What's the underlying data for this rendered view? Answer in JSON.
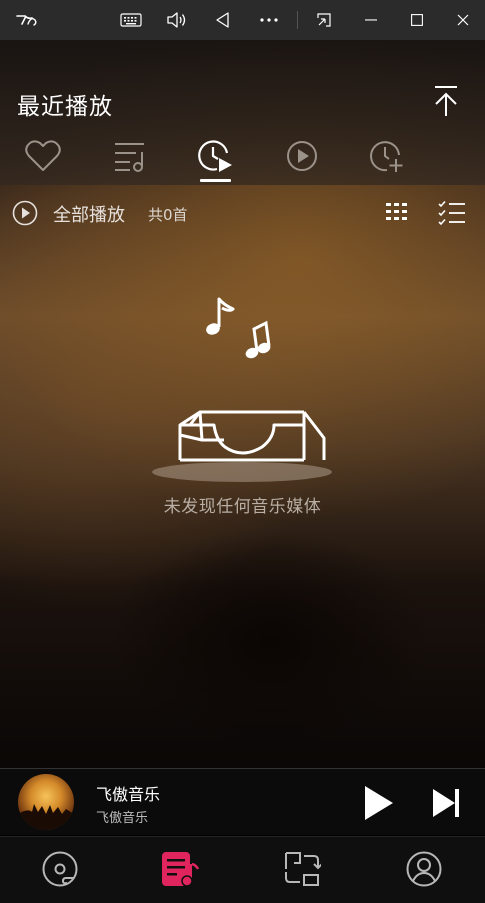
{
  "window": {
    "app_icon": "feiao-logo",
    "buttons": [
      "keyboard-icon",
      "volume-icon",
      "back-triangle-icon",
      "more-icon",
      "compact-overlay-icon",
      "minimize-icon",
      "maximize-icon",
      "close-icon"
    ]
  },
  "page": {
    "title": "最近播放",
    "tabs": [
      "heart-icon",
      "playlist-icon",
      "recent-clock-icon",
      "play-circle-icon",
      "clock-add-icon"
    ],
    "active_tab": 2
  },
  "play_all": {
    "label": "全部播放",
    "count": "共0首"
  },
  "empty_state": {
    "message": "未发现任何音乐媒体"
  },
  "now_playing": {
    "title": "飞傲音乐",
    "artist": "飞傲音乐"
  },
  "bottom_nav": {
    "items": [
      "disc-icon",
      "library-icon",
      "switch-icon",
      "profile-icon"
    ],
    "active_index": 1,
    "active_color": "#e0245e"
  }
}
